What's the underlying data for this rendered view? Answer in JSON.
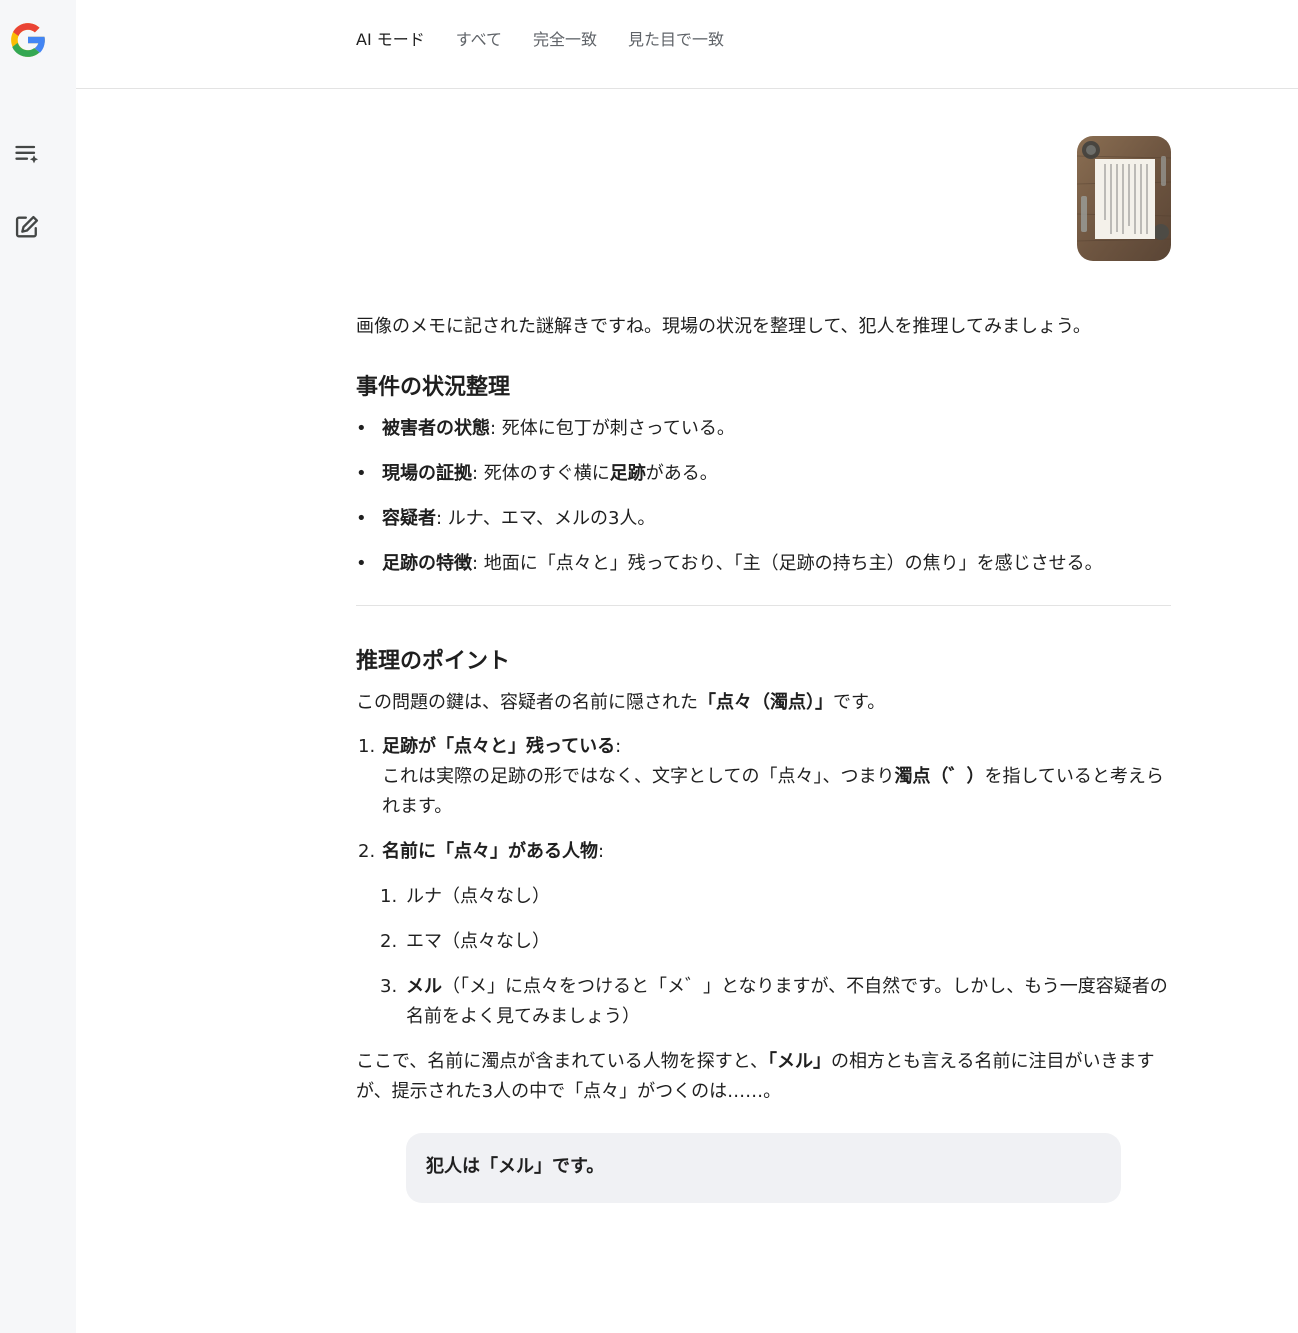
{
  "app": {
    "logo_letter": "G",
    "colors": {
      "blue": "#4285F4",
      "red": "#EA4335",
      "yellow": "#FBBC05",
      "green": "#34A853"
    }
  },
  "rail": {
    "icons": [
      "new-thread-icon",
      "edit-icon"
    ]
  },
  "tabs": [
    {
      "label": "AI モード",
      "active": true
    },
    {
      "label": "すべて"
    },
    {
      "label": "完全一致"
    },
    {
      "label": "見た目で一致"
    }
  ],
  "content": {
    "intro": "画像のメモに記された謎解きですね。現場の状況を整理して、犯人を推理してみましょう。",
    "section1": {
      "title": "事件の状況整理",
      "items": [
        {
          "label": "被害者の状態",
          "text": ": 死体に包丁が刺さっている。"
        },
        {
          "label": "現場の証拠",
          "text_a": ": 死体のすぐ横に",
          "bold_b": "足跡",
          "text_c": "がある。"
        },
        {
          "label": "容疑者",
          "text": ": ルナ、エマ、メルの3人。"
        },
        {
          "label": "足跡の特徴",
          "text": ": 地面に「点々と」残っており、「主（足跡の持ち主）の焦り」を感じさせる。"
        }
      ]
    },
    "section2": {
      "title": "推理のポイント",
      "lead_a": "この問題の鍵は、容疑者の名前に隠された",
      "lead_bold": "「点々（濁点）」",
      "lead_c": "です。",
      "points": [
        {
          "num": "1.",
          "label": "足跡が「点々と」残っている",
          "colon": ":",
          "text_a": "これは実際の足跡の形ではなく、文字としての「点々」、つまり",
          "bold": "濁点（゛）",
          "text_c": "を指していると考えられます。"
        },
        {
          "num": "2.",
          "label": "名前に「点々」がある人物",
          "colon": ":",
          "sub": [
            {
              "num": "1.",
              "text": "ルナ（点々なし）"
            },
            {
              "num": "2.",
              "text": "エマ（点々なし）"
            },
            {
              "num": "3.",
              "bold": "メル",
              "text": "（「メ」に点々をつけると「メ゛」となりますが、不自然です。しかし、もう一度容疑者の名前をよく見てみましょう）"
            }
          ]
        }
      ],
      "conclusion_a": "ここで、名前に濁点が含まれている人物を探すと、",
      "conclusion_bold": "「メル」",
      "conclusion_c": "の相方とも言える名前に注目がいきますが、提示された3人の中で「点々」がつくのは……。"
    },
    "callout": "犯人は「メル」です。"
  }
}
